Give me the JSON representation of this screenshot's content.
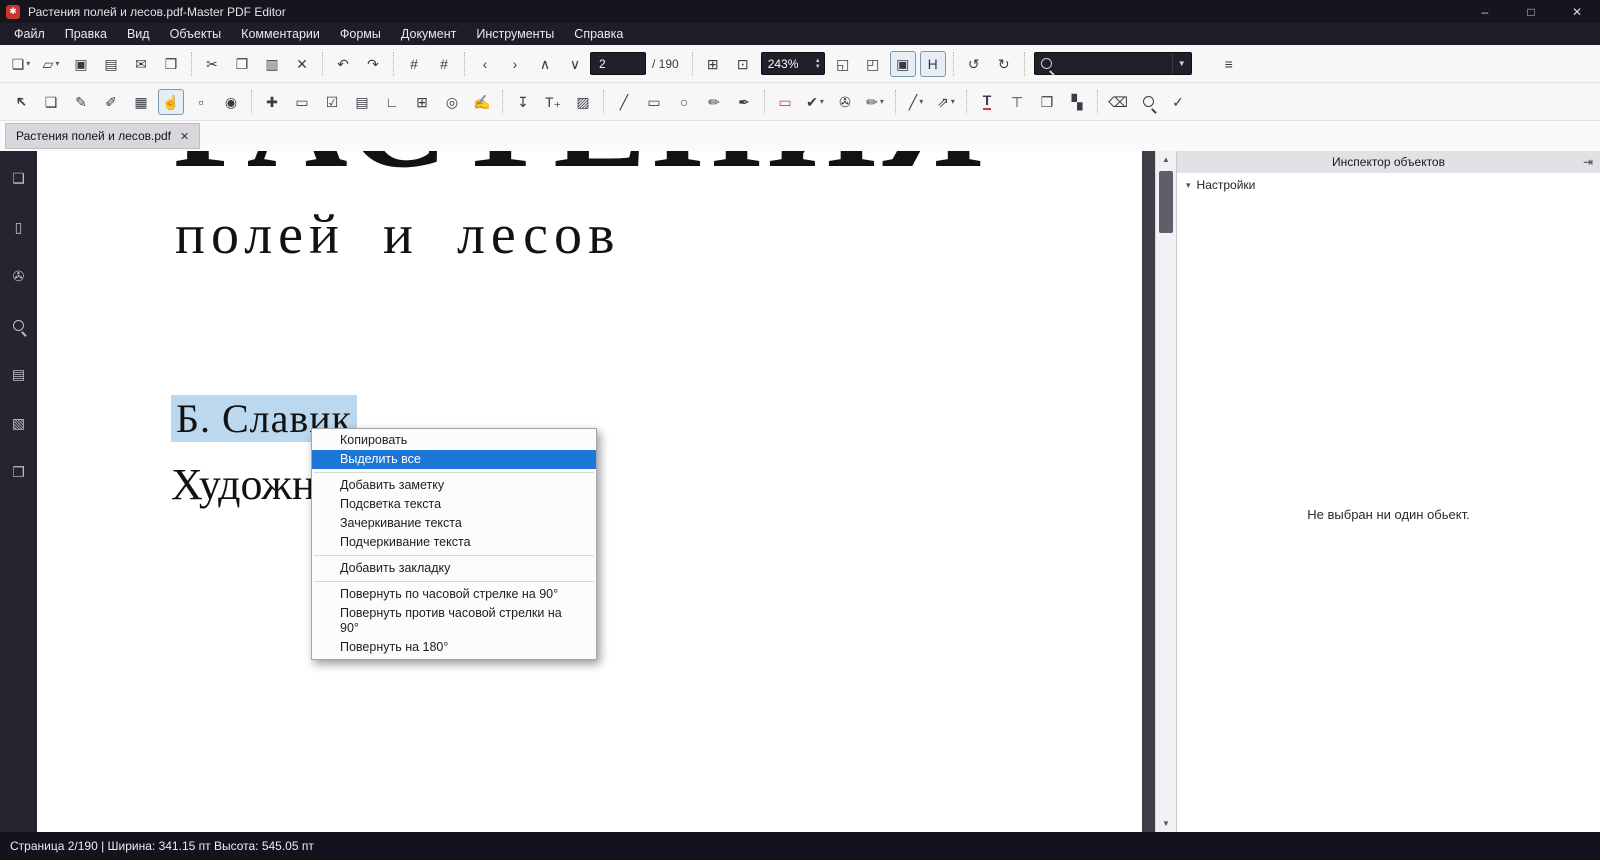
{
  "colors": {
    "titlebar": "#16141d",
    "menubar": "#201d2b",
    "toolbar": "#f7f7f8",
    "sidebar": "#262430",
    "doc_background": "#3f3e47",
    "selection_highlight": "#bcd8ee",
    "menu_selection": "#1c76d5",
    "logo_red": "#c8372d"
  },
  "window": {
    "title": "Растения полей и лесов.pdf-Master PDF Editor",
    "logo_glyph": "✱",
    "controls": {
      "minimize": "–",
      "maximize": "□",
      "close": "✕"
    }
  },
  "menubar": {
    "items": [
      {
        "name": "menu-file",
        "label": "Файл"
      },
      {
        "name": "menu-edit",
        "label": "Правка"
      },
      {
        "name": "menu-view",
        "label": "Вид"
      },
      {
        "name": "menu-objects",
        "label": "Объекты"
      },
      {
        "name": "menu-comments",
        "label": "Комментарии"
      },
      {
        "name": "menu-forms",
        "label": "Формы"
      },
      {
        "name": "menu-document",
        "label": "Документ"
      },
      {
        "name": "menu-tools",
        "label": "Инструменты"
      },
      {
        "name": "menu-help",
        "label": "Справка"
      }
    ]
  },
  "toolbar1": {
    "page_number": "2",
    "page_total": "/ 190",
    "zoom": "243%",
    "search_placeholder": "",
    "items_left": [
      {
        "name": "new-document-button",
        "glyph": "❏",
        "caret": true
      },
      {
        "name": "open-file-button",
        "glyph": "▱",
        "caret": true
      },
      {
        "name": "save-button",
        "glyph": "▣"
      },
      {
        "name": "save-as-button",
        "glyph": "▤"
      },
      {
        "name": "email-button",
        "glyph": "✉"
      },
      {
        "name": "print-button",
        "glyph": "❒"
      },
      {
        "type": "sep"
      },
      {
        "name": "cut-button",
        "glyph": "✂"
      },
      {
        "name": "copy-button",
        "glyph": "❐"
      },
      {
        "name": "paste-button",
        "glyph": "▥"
      },
      {
        "name": "delete-button",
        "glyph": "✕"
      },
      {
        "type": "sep"
      },
      {
        "name": "undo-button",
        "glyph": "↶"
      },
      {
        "name": "redo-button",
        "glyph": "↷"
      },
      {
        "type": "sep"
      },
      {
        "name": "grid-button",
        "glyph": "#"
      },
      {
        "name": "snap-to-grid-button",
        "glyph": "#"
      },
      {
        "type": "sep"
      },
      {
        "name": "previous-page-button",
        "glyph": "‹"
      },
      {
        "name": "next-page-button",
        "glyph": "›"
      },
      {
        "name": "previous-view-button",
        "glyph": "∧"
      },
      {
        "name": "next-view-button",
        "glyph": "∨"
      }
    ],
    "items_mid": [
      {
        "type": "sep"
      },
      {
        "name": "page-preview-button",
        "glyph": "⊞"
      },
      {
        "name": "crop-page-button",
        "glyph": "⊡"
      }
    ],
    "items_right": [
      {
        "name": "fit-window-button",
        "glyph": "◱"
      },
      {
        "name": "fit-width-button",
        "glyph": "◰"
      },
      {
        "name": "fit-page-button",
        "glyph": "▣",
        "active": true
      },
      {
        "name": "hand-mode-button",
        "glyph": "H",
        "active": true
      },
      {
        "type": "sep"
      },
      {
        "name": "rotate-ccw-button",
        "glyph": "↺"
      },
      {
        "name": "rotate-cw-button",
        "glyph": "↻"
      },
      {
        "type": "sep"
      }
    ],
    "items_end": [
      {
        "name": "toolbar-options-button",
        "glyph": "≡"
      }
    ]
  },
  "toolbar2": {
    "items": [
      {
        "name": "select-tool",
        "glyph": "➔",
        "cls": "cursor"
      },
      {
        "name": "edit-document-tool",
        "glyph": "❑"
      },
      {
        "name": "edit-text-tool",
        "glyph": "✎"
      },
      {
        "name": "edit-object-tool",
        "glyph": "✐"
      },
      {
        "name": "edit-forms-tool",
        "glyph": "▦"
      },
      {
        "name": "hand-tool",
        "glyph": "☝",
        "active": true
      },
      {
        "name": "select-area-tool",
        "glyph": "▫"
      },
      {
        "name": "snapshot-tool",
        "glyph": "◉"
      },
      {
        "type": "sep"
      },
      {
        "name": "sticky-note-tool",
        "glyph": "✚"
      },
      {
        "name": "text-annotation-tool",
        "glyph": "▭"
      },
      {
        "name": "check-annotation-tool",
        "glyph": "☑"
      },
      {
        "name": "stamp-tool",
        "glyph": "▤"
      },
      {
        "name": "measure-tool",
        "glyph": "∟"
      },
      {
        "name": "form-field-tool",
        "glyph": "⊞"
      },
      {
        "name": "radio-button-tool",
        "glyph": "◎"
      },
      {
        "name": "signature-tool",
        "glyph": "✍"
      },
      {
        "type": "sep"
      },
      {
        "name": "arrange-text-tool",
        "glyph": "↧"
      },
      {
        "name": "add-text-tool",
        "glyph": "T₊"
      },
      {
        "name": "add-image-tool",
        "glyph": "▨"
      },
      {
        "type": "sep"
      },
      {
        "name": "line-tool",
        "glyph": "╱"
      },
      {
        "name": "rectangle-tool",
        "glyph": "▭"
      },
      {
        "name": "ellipse-tool",
        "glyph": "○"
      },
      {
        "name": "pencil-tool",
        "glyph": "✏"
      },
      {
        "name": "ink-tool",
        "glyph": "✒"
      },
      {
        "type": "sep"
      },
      {
        "name": "marked-area-tool",
        "glyph": "▭",
        "color": "#d23b3b"
      },
      {
        "name": "checkmark-tool",
        "glyph": "✔",
        "caret": true
      },
      {
        "name": "attachment-tool",
        "glyph": "✇"
      },
      {
        "name": "highlighter-tool",
        "glyph": "✏",
        "caret": true
      },
      {
        "type": "sep"
      },
      {
        "name": "polyline-tool",
        "glyph": "╱",
        "caret": true
      },
      {
        "name": "arrow-tool",
        "glyph": "⇗",
        "caret": true
      },
      {
        "type": "sep"
      },
      {
        "name": "highlight-text-tool",
        "glyph": "T",
        "cls": "t-underline"
      },
      {
        "name": "typewriter-tool",
        "glyph": "⊤"
      },
      {
        "name": "insert-pages-tool",
        "glyph": "❒"
      },
      {
        "name": "arrange-pages-tool",
        "glyph": "▚"
      },
      {
        "type": "sep"
      },
      {
        "name": "eraser-tool",
        "glyph": "⌫"
      },
      {
        "name": "zoom-area-tool",
        "glyph": "",
        "cls": "mag"
      },
      {
        "name": "validate-tool",
        "glyph": "✓"
      }
    ]
  },
  "tabbar": {
    "tab_label": "Растения полей и лесов.pdf",
    "close_glyph": "✕"
  },
  "sidebar": {
    "items": [
      {
        "name": "pages-panel-button",
        "glyph": "❑"
      },
      {
        "name": "bookmarks-panel-button",
        "glyph": "▯"
      },
      {
        "name": "attachments-panel-button",
        "glyph": "✇"
      },
      {
        "name": "search-panel-button",
        "glyph": "",
        "cls": "mag"
      },
      {
        "name": "form-fields-panel-button",
        "glyph": "▤"
      },
      {
        "name": "properties-panel-button",
        "glyph": "▧"
      },
      {
        "name": "layers-panel-button",
        "glyph": "❒"
      }
    ]
  },
  "document": {
    "heading_clipped": "РАСТЕНИЯ",
    "subtitle": "полей и лесов",
    "selected_text": "Б. Славик",
    "partial_text": "Художн"
  },
  "context_menu": {
    "items": [
      {
        "name": "context-copy",
        "label": "Копировать"
      },
      {
        "name": "context-select-all",
        "label": "Выделить все",
        "selected": true
      },
      {
        "type": "sep"
      },
      {
        "name": "context-add-note",
        "label": "Добавить заметку"
      },
      {
        "name": "context-highlight-text",
        "label": "Подсветка текста"
      },
      {
        "name": "context-strikeout-text",
        "label": "Зачеркивание текста"
      },
      {
        "name": "context-underline-text",
        "label": "Подчеркивание текста"
      },
      {
        "type": "sep"
      },
      {
        "name": "context-add-bookmark",
        "label": "Добавить закладку"
      },
      {
        "type": "sep"
      },
      {
        "name": "context-rotate-cw-90",
        "label": "Повернуть по часовой стрелке на 90°"
      },
      {
        "name": "context-rotate-ccw-90",
        "label": "Повернуть против часовой стрелки на 90°"
      },
      {
        "name": "context-rotate-180",
        "label": "Повернуть на 180°"
      }
    ]
  },
  "scrollbar": {
    "up_glyph": "▲",
    "down_glyph": "▼"
  },
  "right_panel": {
    "title": "Инспектор объектов",
    "pin_glyph": "⇥",
    "settings_label": "Настройки",
    "settings_arrow": "▾",
    "empty_message": "Не выбран ни один обьект."
  },
  "statusbar": {
    "text": "Страница 2/190 | Ширина: 341.15 пт Высота: 545.05 пт"
  }
}
